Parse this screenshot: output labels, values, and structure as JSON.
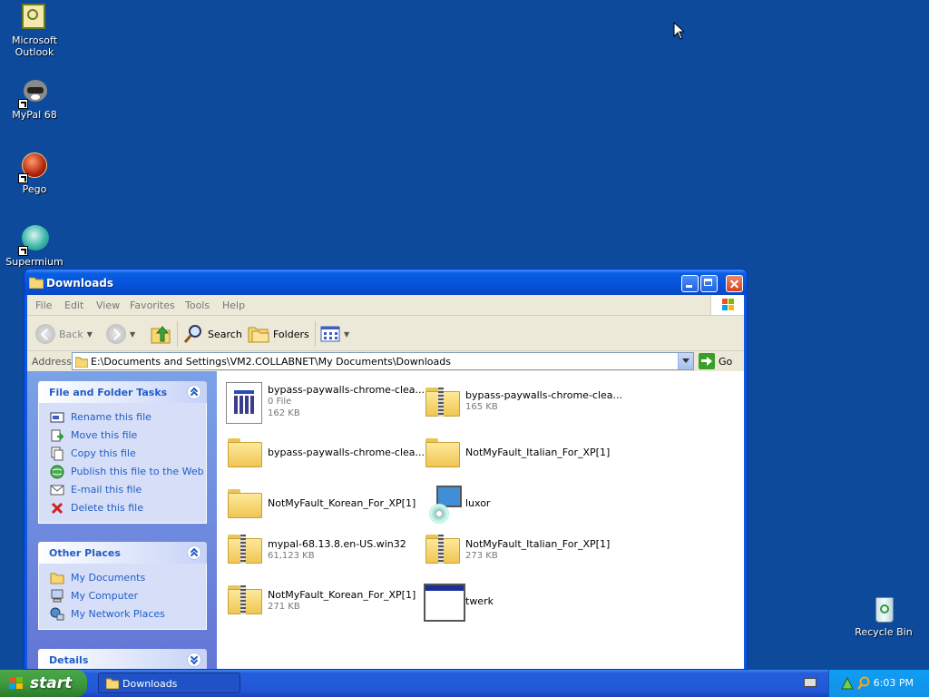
{
  "desktop": {
    "icons": [
      {
        "label": "Microsoft Outlook"
      },
      {
        "label": "MyPal 68"
      },
      {
        "label": "Pego"
      },
      {
        "label": "Supermium"
      },
      {
        "label": "Recycle Bin"
      }
    ]
  },
  "window": {
    "title": "Downloads",
    "menu": [
      "File",
      "Edit",
      "View",
      "Favorites",
      "Tools",
      "Help"
    ],
    "toolbar": {
      "back": "Back",
      "search": "Search",
      "folders": "Folders"
    },
    "address": {
      "label": "Address",
      "value": "E:\\Documents and Settings\\VM2.COLLABNET\\My Documents\\Downloads",
      "go": "Go"
    },
    "tasks": {
      "file_folder_tasks": {
        "title": "File and Folder Tasks",
        "items": [
          "Rename this file",
          "Move this file",
          "Copy this file",
          "Publish this file to the Web",
          "E-mail this file",
          "Delete this file"
        ]
      },
      "other_places": {
        "title": "Other Places",
        "items": [
          "My Documents",
          "My Computer",
          "My Network Places"
        ]
      },
      "details": {
        "title": "Details"
      }
    },
    "files": [
      {
        "name": "bypass-paywalls-chrome-clea...",
        "meta1": "0 File",
        "meta2": "162 KB",
        "icon": "exe-icon"
      },
      {
        "name": "bypass-paywalls-chrome-clea...",
        "meta1": "165 KB",
        "icon": "zip-folder-icon"
      },
      {
        "name": "bypass-paywalls-chrome-clea...",
        "icon": "folder-icon"
      },
      {
        "name": "NotMyFault_Italian_For_XP[1]",
        "icon": "folder-icon"
      },
      {
        "name": "NotMyFault_Korean_For_XP[1]",
        "icon": "folder-icon"
      },
      {
        "name": "luxor",
        "icon": "setup-icon"
      },
      {
        "name": "mypal-68.13.8.en-US.win32",
        "meta1": "61,123 KB",
        "icon": "zip-folder-icon"
      },
      {
        "name": "NotMyFault_Italian_For_XP[1]",
        "meta1": "273 KB",
        "icon": "zip-folder-icon"
      },
      {
        "name": "NotMyFault_Korean_For_XP[1]",
        "meta1": "271 KB",
        "icon": "zip-folder-icon"
      },
      {
        "name": "twerk",
        "icon": "window-app-icon"
      }
    ]
  },
  "taskbar": {
    "start": "start",
    "task_button": "Downloads",
    "clock": "6:03 PM"
  },
  "colors": {
    "desktop": "#0d4a9c",
    "link": "#215dc6",
    "title_bar": "#0553d8"
  }
}
